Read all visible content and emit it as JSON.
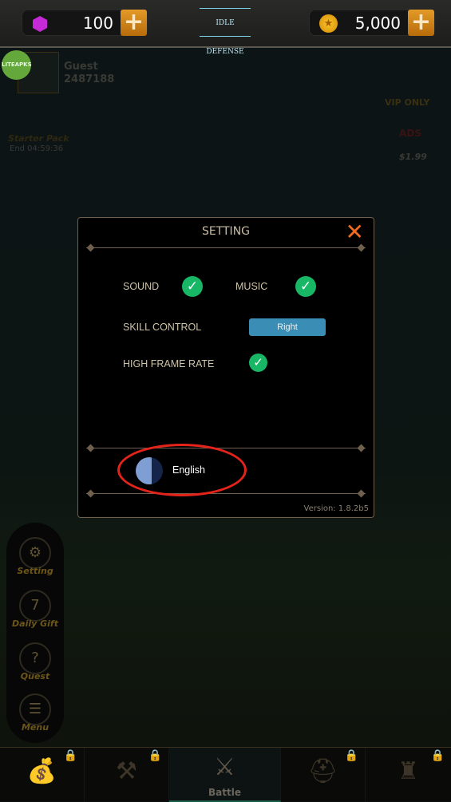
{
  "topbar": {
    "gems": "100",
    "coins": "5,000",
    "plus": "+",
    "logo": "IDLE DEFENSE"
  },
  "background": {
    "watermark": "LITEAPKS",
    "player_name": "Guest",
    "player_id": "2487188",
    "vip": "VIP ONLY",
    "ads_label": "ADS",
    "ads_price": "$1.99",
    "starter_pack": "Starter Pack",
    "starter_timer": "End 04:59:36"
  },
  "dialog": {
    "title": "SETTING",
    "close": "✕",
    "sound_label": "SOUND",
    "sound_on": true,
    "music_label": "MUSIC",
    "music_on": true,
    "skill_control_label": "SKILL CONTROL",
    "skill_control_value": "Right",
    "high_frame_rate_label": "HIGH FRAME RATE",
    "high_frame_rate_on": true,
    "language": "English",
    "version": "Version: 1.8.2b5",
    "check": "✓"
  },
  "side_menu": [
    {
      "label": "Setting",
      "icon": "gear-icon",
      "glyph": "⚙"
    },
    {
      "label": "Daily Gift",
      "icon": "calendar-icon",
      "glyph": "7"
    },
    {
      "label": "Quest",
      "icon": "scroll-icon",
      "glyph": "?"
    },
    {
      "label": "Menu",
      "icon": "menu-icon",
      "glyph": "☰"
    }
  ],
  "bottom_nav": {
    "battle": "Battle",
    "lock": "🔒"
  },
  "colors": {
    "accent_orange": "#f26a1b",
    "check_green": "#17b765",
    "button_blue": "#3a8db5",
    "highlight_red": "#e4231a"
  }
}
